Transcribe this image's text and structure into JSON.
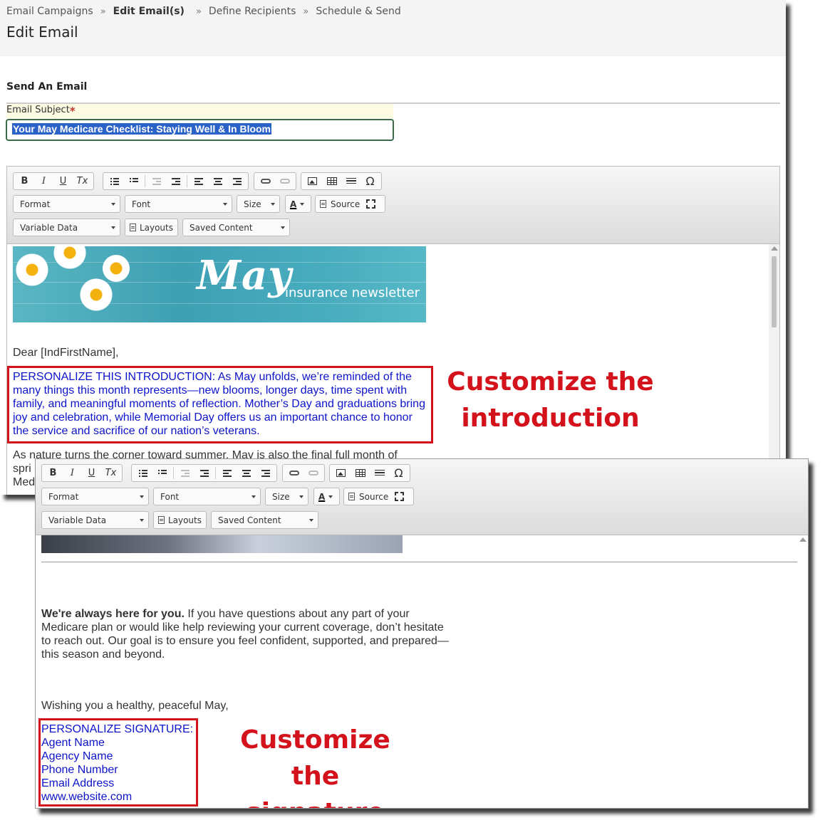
{
  "breadcrumb": {
    "items": [
      "Email Campaigns",
      "Edit Email(s)",
      "Define Recipients",
      "Schedule & Send"
    ],
    "separator": "»"
  },
  "page_title": "Edit Email",
  "section_title": "Send An Email",
  "subject": {
    "label": "Email Subject",
    "required_mark": "*",
    "value": "Your May Medicare Checklist: Staying Well & In Bloom"
  },
  "toolbar": {
    "bold": "B",
    "italic": "I",
    "underline": "U",
    "remove_format": "Tx",
    "special_char": "Ω",
    "format_label": "Format",
    "font_label": "Font",
    "size_label": "Size",
    "text_color": "A",
    "source_label": "Source",
    "variable_data_label": "Variable Data",
    "layouts_label": "Layouts",
    "saved_content_label": "Saved Content"
  },
  "banner": {
    "title": "May",
    "subtitle": "insurance newsletter"
  },
  "email_top": {
    "greeting": "Dear [IndFirstName],",
    "intro": "PERSONALIZE THIS INTRODUCTION: As May unfolds, we’re reminded of the many things this month represents—new blooms, longer days, time spent with family, and meaningful moments of reflection. Mother’s Day and graduations bring joy and celebration, while Memorial Day offers us an important chance to honor the service and sacrifice of our nation’s veterans.",
    "para2_fragment": "As nature turns the corner toward summer, May is also the final full month of",
    "para2_line2": "spri",
    "para2_line3": "Med"
  },
  "email_bottom": {
    "closing_bold": "We're always here for you.",
    "closing_text": " If you have questions about any part of your Medicare plan or would like help reviewing your current coverage, don’t hesitate to reach out. Our goal is to ensure you feel confident, supported, and prepared—this season and beyond.",
    "signoff": "Wishing you a healthy, peaceful May,",
    "signature": [
      "PERSONALIZE SIGNATURE:",
      "Agent Name",
      "Agency Name",
      "Phone Number",
      "Email Address",
      "www.website.com"
    ]
  },
  "callouts": {
    "intro_line1": "Customize the",
    "intro_line2": "introduction",
    "sig_line1": "Customize the",
    "sig_line2": "signature"
  },
  "colors": {
    "accent_red": "#d3121b",
    "personalize_blue": "#0d14c9",
    "selection_blue": "#2a62c8",
    "banner_teal": "#48acbf"
  }
}
